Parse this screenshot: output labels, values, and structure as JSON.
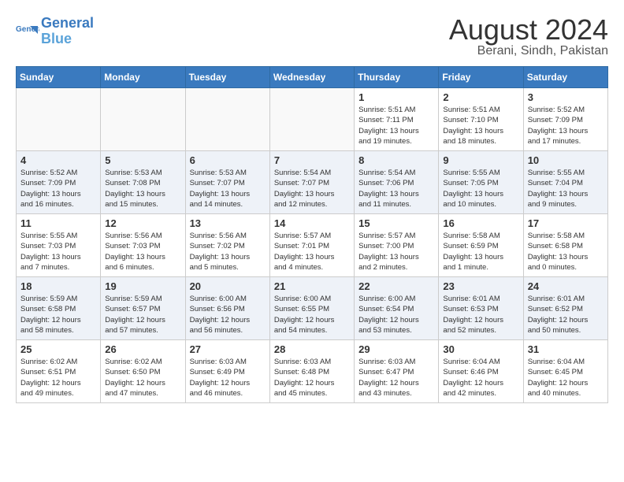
{
  "header": {
    "logo_line1": "General",
    "logo_line2": "Blue",
    "month_year": "August 2024",
    "location": "Berani, Sindh, Pakistan"
  },
  "days_of_week": [
    "Sunday",
    "Monday",
    "Tuesday",
    "Wednesday",
    "Thursday",
    "Friday",
    "Saturday"
  ],
  "weeks": [
    {
      "days": [
        {
          "num": "",
          "detail": ""
        },
        {
          "num": "",
          "detail": ""
        },
        {
          "num": "",
          "detail": ""
        },
        {
          "num": "",
          "detail": ""
        },
        {
          "num": "1",
          "detail": "Sunrise: 5:51 AM\nSunset: 7:11 PM\nDaylight: 13 hours\nand 19 minutes."
        },
        {
          "num": "2",
          "detail": "Sunrise: 5:51 AM\nSunset: 7:10 PM\nDaylight: 13 hours\nand 18 minutes."
        },
        {
          "num": "3",
          "detail": "Sunrise: 5:52 AM\nSunset: 7:09 PM\nDaylight: 13 hours\nand 17 minutes."
        }
      ]
    },
    {
      "days": [
        {
          "num": "4",
          "detail": "Sunrise: 5:52 AM\nSunset: 7:09 PM\nDaylight: 13 hours\nand 16 minutes."
        },
        {
          "num": "5",
          "detail": "Sunrise: 5:53 AM\nSunset: 7:08 PM\nDaylight: 13 hours\nand 15 minutes."
        },
        {
          "num": "6",
          "detail": "Sunrise: 5:53 AM\nSunset: 7:07 PM\nDaylight: 13 hours\nand 14 minutes."
        },
        {
          "num": "7",
          "detail": "Sunrise: 5:54 AM\nSunset: 7:07 PM\nDaylight: 13 hours\nand 12 minutes."
        },
        {
          "num": "8",
          "detail": "Sunrise: 5:54 AM\nSunset: 7:06 PM\nDaylight: 13 hours\nand 11 minutes."
        },
        {
          "num": "9",
          "detail": "Sunrise: 5:55 AM\nSunset: 7:05 PM\nDaylight: 13 hours\nand 10 minutes."
        },
        {
          "num": "10",
          "detail": "Sunrise: 5:55 AM\nSunset: 7:04 PM\nDaylight: 13 hours\nand 9 minutes."
        }
      ]
    },
    {
      "days": [
        {
          "num": "11",
          "detail": "Sunrise: 5:55 AM\nSunset: 7:03 PM\nDaylight: 13 hours\nand 7 minutes."
        },
        {
          "num": "12",
          "detail": "Sunrise: 5:56 AM\nSunset: 7:03 PM\nDaylight: 13 hours\nand 6 minutes."
        },
        {
          "num": "13",
          "detail": "Sunrise: 5:56 AM\nSunset: 7:02 PM\nDaylight: 13 hours\nand 5 minutes."
        },
        {
          "num": "14",
          "detail": "Sunrise: 5:57 AM\nSunset: 7:01 PM\nDaylight: 13 hours\nand 4 minutes."
        },
        {
          "num": "15",
          "detail": "Sunrise: 5:57 AM\nSunset: 7:00 PM\nDaylight: 13 hours\nand 2 minutes."
        },
        {
          "num": "16",
          "detail": "Sunrise: 5:58 AM\nSunset: 6:59 PM\nDaylight: 13 hours\nand 1 minute."
        },
        {
          "num": "17",
          "detail": "Sunrise: 5:58 AM\nSunset: 6:58 PM\nDaylight: 13 hours\nand 0 minutes."
        }
      ]
    },
    {
      "days": [
        {
          "num": "18",
          "detail": "Sunrise: 5:59 AM\nSunset: 6:58 PM\nDaylight: 12 hours\nand 58 minutes."
        },
        {
          "num": "19",
          "detail": "Sunrise: 5:59 AM\nSunset: 6:57 PM\nDaylight: 12 hours\nand 57 minutes."
        },
        {
          "num": "20",
          "detail": "Sunrise: 6:00 AM\nSunset: 6:56 PM\nDaylight: 12 hours\nand 56 minutes."
        },
        {
          "num": "21",
          "detail": "Sunrise: 6:00 AM\nSunset: 6:55 PM\nDaylight: 12 hours\nand 54 minutes."
        },
        {
          "num": "22",
          "detail": "Sunrise: 6:00 AM\nSunset: 6:54 PM\nDaylight: 12 hours\nand 53 minutes."
        },
        {
          "num": "23",
          "detail": "Sunrise: 6:01 AM\nSunset: 6:53 PM\nDaylight: 12 hours\nand 52 minutes."
        },
        {
          "num": "24",
          "detail": "Sunrise: 6:01 AM\nSunset: 6:52 PM\nDaylight: 12 hours\nand 50 minutes."
        }
      ]
    },
    {
      "days": [
        {
          "num": "25",
          "detail": "Sunrise: 6:02 AM\nSunset: 6:51 PM\nDaylight: 12 hours\nand 49 minutes."
        },
        {
          "num": "26",
          "detail": "Sunrise: 6:02 AM\nSunset: 6:50 PM\nDaylight: 12 hours\nand 47 minutes."
        },
        {
          "num": "27",
          "detail": "Sunrise: 6:03 AM\nSunset: 6:49 PM\nDaylight: 12 hours\nand 46 minutes."
        },
        {
          "num": "28",
          "detail": "Sunrise: 6:03 AM\nSunset: 6:48 PM\nDaylight: 12 hours\nand 45 minutes."
        },
        {
          "num": "29",
          "detail": "Sunrise: 6:03 AM\nSunset: 6:47 PM\nDaylight: 12 hours\nand 43 minutes."
        },
        {
          "num": "30",
          "detail": "Sunrise: 6:04 AM\nSunset: 6:46 PM\nDaylight: 12 hours\nand 42 minutes."
        },
        {
          "num": "31",
          "detail": "Sunrise: 6:04 AM\nSunset: 6:45 PM\nDaylight: 12 hours\nand 40 minutes."
        }
      ]
    }
  ]
}
